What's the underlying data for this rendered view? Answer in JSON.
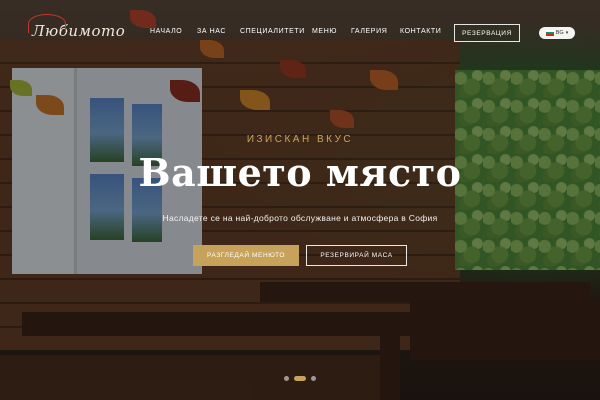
{
  "brand": {
    "logo_text": "Любимото"
  },
  "nav": {
    "items": [
      {
        "label": "НАЧАЛО"
      },
      {
        "label": "ЗА НАС"
      },
      {
        "label": "СПЕЦИАЛИТЕТИ"
      },
      {
        "label": "МЕНЮ"
      },
      {
        "label": "ГАЛЕРИЯ"
      },
      {
        "label": "КОНТАКТИ"
      }
    ],
    "reserve_label": "РЕЗЕРВАЦИЯ",
    "language": {
      "code": "BG",
      "icon": "bulgarian-flag-icon"
    }
  },
  "hero": {
    "eyebrow": "ИЗИСКАН ВКУС",
    "headline": "Вашето място",
    "subline": "Насладете се на най-доброто обслужване и атмосфера в София",
    "primary_button": "РАЗГЛЕДАЙ МЕНЮТО",
    "secondary_button": "РЕЗЕРВИРАЙ МАСА",
    "slides_total": 3,
    "active_slide": 2
  },
  "colors": {
    "accent": "#c7a25a",
    "text": "#ffffff",
    "logo_heart": "#c0392b"
  }
}
